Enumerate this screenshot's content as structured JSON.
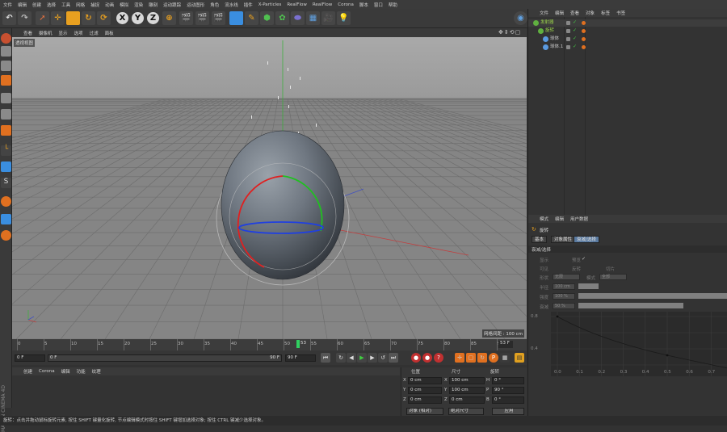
{
  "menu": [
    "文件",
    "编辑",
    "创建",
    "选择",
    "工具",
    "网格",
    "捕捉",
    "动画",
    "模拟",
    "渲染",
    "雕刻",
    "运动跟踪",
    "运动图形",
    "角色",
    "流水线",
    "插件",
    "X-Particles",
    "RealFlow",
    "RealFlow",
    "Corona",
    "脚本",
    "窗口",
    "帮助"
  ],
  "toolbar": {
    "axis_x": "X",
    "axis_y": "Y",
    "axis_z": "Z"
  },
  "viewport": {
    "menu": [
      "查看",
      "摄像机",
      "显示",
      "选项",
      "过滤",
      "面板"
    ],
    "label": "透视视图",
    "grid_spacing": "网格间距 : 100 cm"
  },
  "timeline": {
    "ticks": [
      "0",
      "5",
      "10",
      "15",
      "20",
      "25",
      "30",
      "35",
      "40",
      "45",
      "50",
      "55",
      "60",
      "65",
      "70",
      "75",
      "80",
      "85",
      "90"
    ],
    "current_frame": "53",
    "end_frame_label": "53 F"
  },
  "transport": {
    "start": "0 F",
    "min": "0 F",
    "max": "90 F",
    "end": "90 F"
  },
  "material": {
    "menu": [
      "创建",
      "Corona",
      "编辑",
      "功能",
      "纹理"
    ]
  },
  "coordinates": {
    "headers": [
      "位置",
      "尺寸",
      "旋转"
    ],
    "rows": [
      {
        "axis": "X",
        "pos": "0 cm",
        "size_axis": "X",
        "size": "100 cm",
        "rot_axis": "H",
        "rot": "0 °"
      },
      {
        "axis": "Y",
        "pos": "0 cm",
        "size_axis": "Y",
        "size": "100 cm",
        "rot_axis": "P",
        "rot": "90 °"
      },
      {
        "axis": "Z",
        "pos": "0 cm",
        "size_axis": "Z",
        "size": "0 cm",
        "rot_axis": "B",
        "rot": "0 °"
      }
    ],
    "mode_object": "对象 (相对)",
    "mode_size": "绝对尺寸",
    "apply": "应用"
  },
  "object_manager": {
    "menu": [
      "文件",
      "编辑",
      "查看",
      "对象",
      "标签",
      "书签"
    ],
    "items": [
      {
        "name": "发射器",
        "indent": 0,
        "color": "#9ad24a"
      },
      {
        "name": "旋转",
        "indent": 1,
        "color": "#9ad24a"
      },
      {
        "name": "球体",
        "indent": 2,
        "color": "#c8c8c8"
      },
      {
        "name": "球体.1",
        "indent": 2,
        "color": "#c8c8c8"
      }
    ]
  },
  "attributes": {
    "menu": [
      "模式",
      "编辑",
      "用户数据"
    ],
    "object_name": "旋转",
    "tabs": [
      "基本",
      "对象属性",
      "衰减/选择"
    ],
    "section": "衰减/选择",
    "labels": {
      "display": "显示",
      "visible": "可见",
      "invert": "反转",
      "preview": "预览",
      "shape": "形状",
      "shape_value": "无限",
      "slice": "切片",
      "mode": "模式",
      "mode_value": "全部",
      "radius": "半径",
      "radius_value": "100 cm",
      "strength": "强度",
      "strength_value": "100 %",
      "falloff": "衰减",
      "falloff_value": "50 %"
    },
    "graph_y": [
      "0.8",
      "0.4"
    ],
    "graph_x": [
      "0.0",
      "0.1",
      "0.2",
      "0.3",
      "0.4",
      "0.5",
      "0.6",
      "0.7"
    ]
  },
  "status": "旋转：点击并拖动鼠标旋转元素, 按住 SHIFT 键量化旋转, 节点编辑模式时按住 SHIFT 键增加选择对象; 按住 CTRL 键减少选择对象。",
  "logo_text": "MAXON CINEMA 4D"
}
